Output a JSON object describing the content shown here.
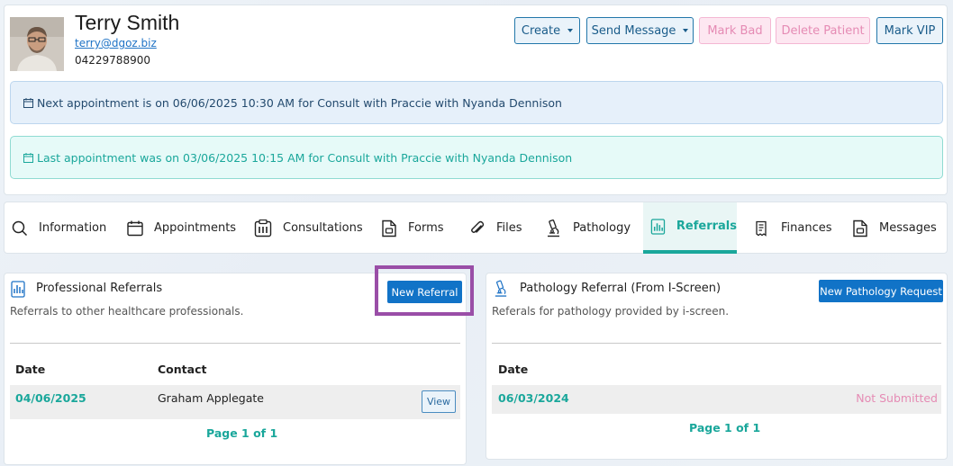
{
  "patient": {
    "name": "Terry Smith",
    "email": "terry@dgoz.biz",
    "phone": "04229788900"
  },
  "header_buttons": {
    "create": "Create",
    "send_message": "Send Message",
    "mark_bad": "Mark Bad",
    "delete_patient": "Delete Patient",
    "mark_vip": "Mark VIP"
  },
  "appointments": {
    "next": "Next appointment is on 06/06/2025 10:30 AM for Consult with Praccie with Nyanda Dennison",
    "last": "Last appointment was on 03/06/2025 10:15 AM for Consult with Praccie with Nyanda Dennison"
  },
  "tabs": [
    {
      "label": "Information",
      "icon": "search-icon"
    },
    {
      "label": "Appointments",
      "icon": "calendar-icon"
    },
    {
      "label": "Consultations",
      "icon": "clipboard-icon"
    },
    {
      "label": "Forms",
      "icon": "form-icon"
    },
    {
      "label": "Files",
      "icon": "paperclip-icon"
    },
    {
      "label": "Pathology",
      "icon": "microscope-icon"
    },
    {
      "label": "Referrals",
      "icon": "chart-document-icon",
      "active": true
    },
    {
      "label": "Finances",
      "icon": "receipt-icon"
    },
    {
      "label": "Messages",
      "icon": "message-icon"
    }
  ],
  "professional_referrals": {
    "title": "Professional Referrals",
    "description": "Referrals to other healthcare professionals.",
    "new_button": "New Referral",
    "columns": [
      "Date",
      "Contact"
    ],
    "rows": [
      {
        "date": "04/06/2025",
        "contact": "Graham Applegate",
        "action": "View"
      }
    ],
    "pager": "Page 1 of 1"
  },
  "pathology_referrals": {
    "title": "Pathology Referral (From I-Screen)",
    "description": "Referals for pathology provided by i-screen.",
    "new_button": "New Pathology Request",
    "columns": [
      "Date"
    ],
    "rows": [
      {
        "date": "06/03/2024",
        "status": "Not Submitted"
      }
    ],
    "pager": "Page 1 of 1"
  },
  "colors": {
    "accent_teal": "#1aa79b",
    "primary_blue": "#1173c7",
    "pink": "#e58bb4",
    "highlight_purple": "#9a4ea7"
  }
}
